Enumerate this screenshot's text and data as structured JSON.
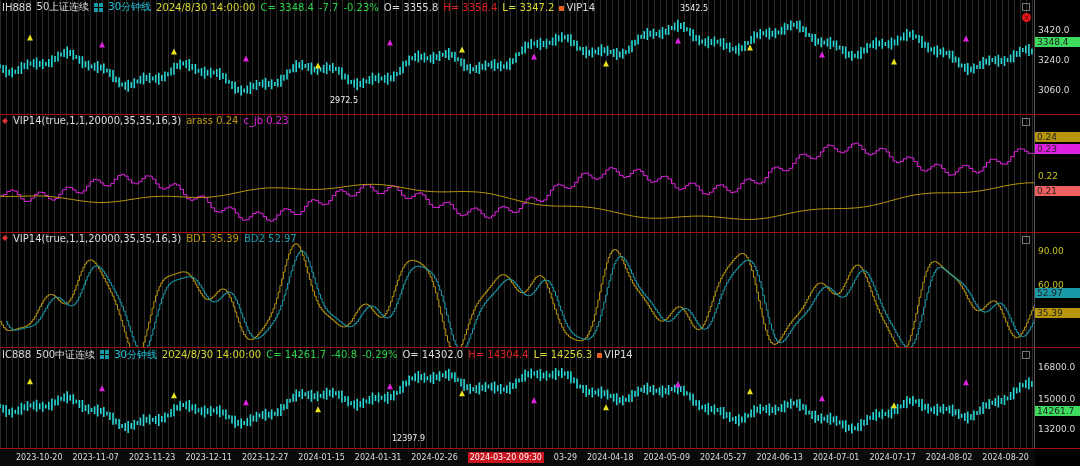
{
  "panels": [
    {
      "kind": "price",
      "header": [
        {
          "kind": "symbol",
          "text": "IH888"
        },
        {
          "kind": "name",
          "text": "50上证连续"
        },
        {
          "kind": "grid"
        },
        {
          "kind": "period",
          "text": "30分钟线"
        },
        {
          "kind": "date",
          "text": "2024/8/30 14:00:00"
        },
        {
          "kind": "down",
          "text": "C= 3348.4"
        },
        {
          "kind": "down",
          "text": "-7.7"
        },
        {
          "kind": "down",
          "text": "-0.23%"
        },
        {
          "kind": "plain",
          "text": "O= 3355.8"
        },
        {
          "kind": "up",
          "text": "H= 3358.4"
        },
        {
          "kind": "low",
          "text": "L= 3347.2"
        },
        {
          "kind": "tag",
          "text": "VIP14"
        }
      ],
      "annotations": [
        "3542.5",
        "2972.5"
      ],
      "axis": [
        {
          "kind": "tick",
          "label": "3420.0"
        },
        {
          "kind": "badge",
          "label": "3348.4",
          "color": "#3ddc5f"
        },
        {
          "kind": "tick",
          "label": "3240.0"
        },
        {
          "kind": "tick",
          "label": "3060.0"
        }
      ],
      "close_icon": true
    },
    {
      "kind": "ratio",
      "header": [
        {
          "kind": "dot"
        },
        {
          "kind": "plain",
          "text": "VIP14(true,1,1,20000,35,35,16,3)"
        },
        {
          "kind": "olive",
          "text": "arass 0.24"
        },
        {
          "kind": "magenta",
          "text": "c_jb 0.23"
        }
      ],
      "axis": [
        {
          "kind": "badge",
          "label": "0.24",
          "color": "#b8960c"
        },
        {
          "kind": "badge",
          "label": "0.23",
          "color": "#e020e0"
        },
        {
          "kind": "tick",
          "label": "0.22"
        },
        {
          "kind": "badge",
          "label": "0.21",
          "color": "#f06060"
        }
      ]
    },
    {
      "kind": "oscillator",
      "header": [
        {
          "kind": "dot"
        },
        {
          "kind": "plain",
          "text": "VIP14(true,1,1,20000,35,35,16,3)"
        },
        {
          "kind": "olive",
          "text": "BD1 35.39"
        },
        {
          "kind": "teal",
          "text": "BD2 52.97"
        }
      ],
      "axis": [
        {
          "kind": "tick",
          "label": "90.00"
        },
        {
          "kind": "tick",
          "label": "60.00"
        },
        {
          "kind": "badge",
          "label": "52.97",
          "color": "#1a9aa8"
        },
        {
          "kind": "badge",
          "label": "35.39",
          "color": "#b8960c"
        }
      ]
    },
    {
      "kind": "price",
      "header": [
        {
          "kind": "symbol",
          "text": "IC888"
        },
        {
          "kind": "name",
          "text": "500中证连续"
        },
        {
          "kind": "grid"
        },
        {
          "kind": "period",
          "text": "30分钟线"
        },
        {
          "kind": "date",
          "text": "2024/8/30 14:00:00"
        },
        {
          "kind": "down",
          "text": "C= 14261.7"
        },
        {
          "kind": "down",
          "text": "-40.8"
        },
        {
          "kind": "down",
          "text": "-0.29%"
        },
        {
          "kind": "plain",
          "text": "O= 14302.0"
        },
        {
          "kind": "up",
          "text": "H= 14304.4"
        },
        {
          "kind": "low",
          "text": "L= 14256.3"
        },
        {
          "kind": "tag",
          "text": "VIP14"
        }
      ],
      "annotations": [
        "12397.9"
      ],
      "axis": [
        {
          "kind": "tick",
          "label": "16800.0"
        },
        {
          "kind": "tick",
          "label": "15000.0"
        },
        {
          "kind": "badge",
          "label": "14261.7",
          "color": "#3ddc5f"
        },
        {
          "kind": "tick",
          "label": "13200.0"
        }
      ]
    }
  ],
  "time_axis": [
    {
      "kind": "date",
      "label": "2023-10-20"
    },
    {
      "kind": "date",
      "label": "2023-11-07"
    },
    {
      "kind": "date",
      "label": "2023-11-23"
    },
    {
      "kind": "date",
      "label": "2023-12-11"
    },
    {
      "kind": "date",
      "label": "2023-12-27"
    },
    {
      "kind": "date",
      "label": "2024-01-15"
    },
    {
      "kind": "date",
      "label": "2024-01-31"
    },
    {
      "kind": "date",
      "label": "2024-02-26"
    },
    {
      "kind": "cursor",
      "label": "2024-03-20 09:30"
    },
    {
      "kind": "date",
      "label": "03-29"
    },
    {
      "kind": "date",
      "label": "2024-04-18"
    },
    {
      "kind": "date",
      "label": "2024-05-09"
    },
    {
      "kind": "date",
      "label": "2024-05-27"
    },
    {
      "kind": "date",
      "label": "2024-06-13"
    },
    {
      "kind": "date",
      "label": "2024-07-01"
    },
    {
      "kind": "date",
      "label": "2024-07-17"
    },
    {
      "kind": "date",
      "label": "2024-08-02"
    },
    {
      "kind": "date",
      "label": "2024-08-20"
    }
  ]
}
